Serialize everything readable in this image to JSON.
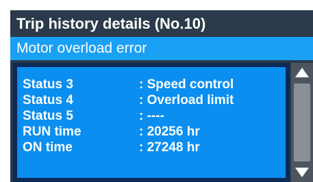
{
  "title": "Trip history details (No.10)",
  "error_message": "Motor overload error",
  "details": [
    {
      "label": "Status 3",
      "value": ": Speed control"
    },
    {
      "label": "Status 4",
      "value": ": Overload limit"
    },
    {
      "label": "Status 5",
      "value": ": ----"
    },
    {
      "label": "RUN time",
      "value": ": 20256 hr"
    },
    {
      "label": "ON time",
      "value": ": 27248 hr"
    }
  ],
  "scrollbar": {
    "up_icon": "triangle-up-icon",
    "down_icon": "triangle-down-icon"
  },
  "colors": {
    "title_bg": "#2b3a4a",
    "error_bg": "#1aa0f5",
    "content_bg": "#0a8ef0",
    "frame": "#0b2a55",
    "scrollbar_bg": "#4d5660"
  }
}
